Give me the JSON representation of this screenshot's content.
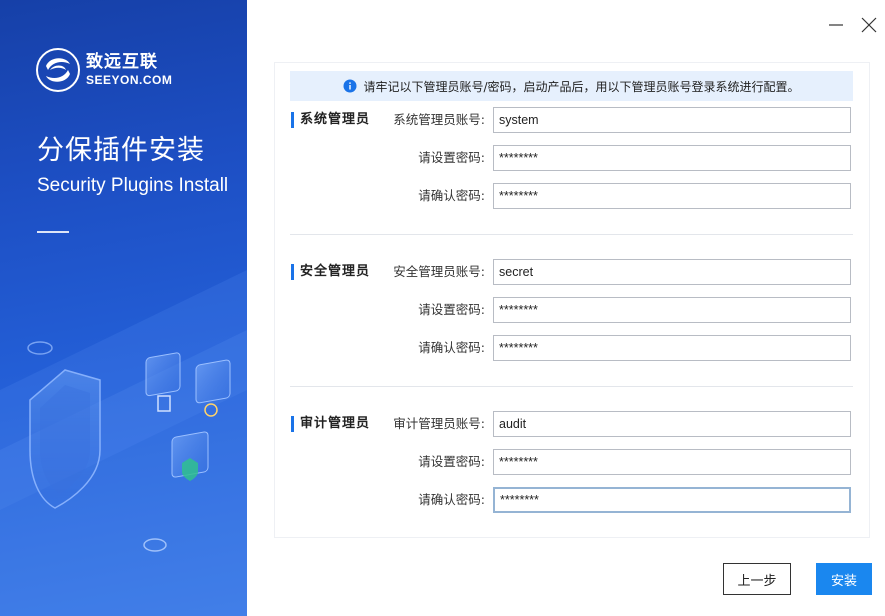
{
  "brand": {
    "name_cn": "致远互联",
    "name_en": "SEEYON.COM"
  },
  "product": {
    "title": "分保插件安装",
    "subtitle": "Security Plugins Install"
  },
  "window": {
    "minimize_icon": "minus-icon",
    "close_icon": "close-icon"
  },
  "notice": {
    "icon": "info-icon",
    "text": "请牢记以下管理员账号/密码，启动产品后，用以下管理员账号登录系统进行配置。"
  },
  "sections": [
    {
      "title": "系统管理员",
      "account_label": "系统管理员账号:",
      "account_value": "system",
      "password_label": "请设置密码:",
      "password_value": "********",
      "confirm_label": "请确认密码:",
      "confirm_value": "********"
    },
    {
      "title": "安全管理员",
      "account_label": "安全管理员账号:",
      "account_value": "secret",
      "password_label": "请设置密码:",
      "password_value": "********",
      "confirm_label": "请确认密码:",
      "confirm_value": "********"
    },
    {
      "title": "审计管理员",
      "account_label": "审计管理员账号:",
      "account_value": "audit",
      "password_label": "请设置密码:",
      "password_value": "********",
      "confirm_label": "请确认密码:",
      "confirm_value": "********"
    }
  ],
  "buttons": {
    "prev": "上一步",
    "install": "安装"
  },
  "colors": {
    "accent": "#1a87ef",
    "banner": "#1d4fc4",
    "notice_bg": "#e6f0fd"
  }
}
